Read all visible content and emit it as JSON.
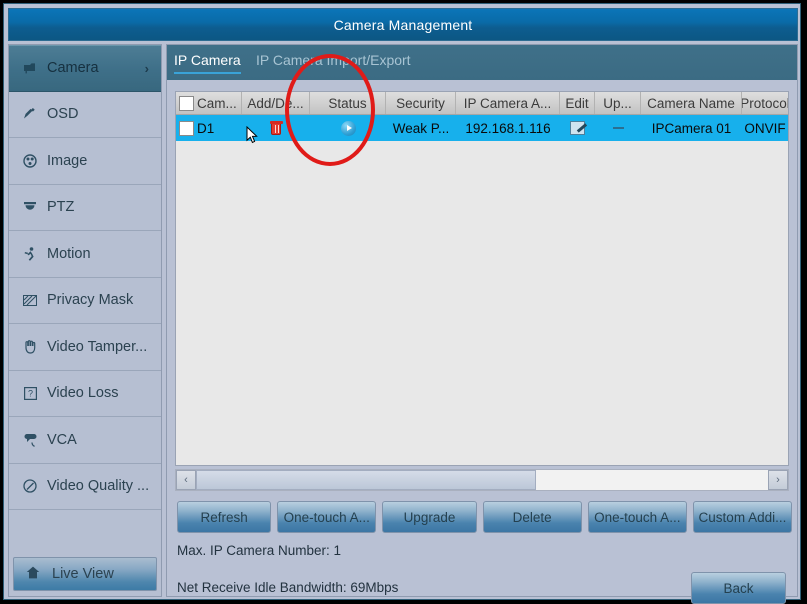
{
  "window": {
    "title": "Camera Management"
  },
  "sidebar": {
    "items": [
      {
        "label": "Camera",
        "icon": "camera-icon",
        "active": true,
        "chevron": "›"
      },
      {
        "label": "OSD",
        "icon": "osd-icon",
        "active": false,
        "chevron": ""
      },
      {
        "label": "Image",
        "icon": "image-icon",
        "active": false,
        "chevron": ""
      },
      {
        "label": "PTZ",
        "icon": "ptz-icon",
        "active": false,
        "chevron": ""
      },
      {
        "label": "Motion",
        "icon": "motion-icon",
        "active": false,
        "chevron": ""
      },
      {
        "label": "Privacy Mask",
        "icon": "privacy-mask-icon",
        "active": false,
        "chevron": ""
      },
      {
        "label": "Video Tamper...",
        "icon": "video-tamper-icon",
        "active": false,
        "chevron": ""
      },
      {
        "label": "Video Loss",
        "icon": "video-loss-icon",
        "active": false,
        "chevron": ""
      },
      {
        "label": "VCA",
        "icon": "vca-icon",
        "active": false,
        "chevron": ""
      },
      {
        "label": "Video Quality ...",
        "icon": "video-quality-icon",
        "active": false,
        "chevron": ""
      }
    ],
    "live_view": {
      "label": "Live View",
      "icon": "home-icon"
    }
  },
  "tabs": [
    {
      "label": "IP Camera",
      "active": true
    },
    {
      "label": "IP Camera Import/Export",
      "active": false
    }
  ],
  "table": {
    "columns": [
      "Cam...",
      "Add/De...",
      "Status",
      "Security",
      "IP Camera A...",
      "Edit",
      "Up...",
      "Camera Name",
      "Protocol"
    ],
    "rows": [
      {
        "channel": "D1",
        "add_delete_icon": "delete-trash-icon",
        "status_icon": "play-circle-icon",
        "security": "Weak P...",
        "ip_address": "192.168.1.116",
        "edit_icon": "edit-pencil-icon",
        "upgrade": "—",
        "camera_name": "IPCamera 01",
        "protocol": "ONVIF",
        "selected": true,
        "checked": false
      }
    ],
    "header_checkbox_checked": false
  },
  "scrollbar": {
    "left_arrow": "‹",
    "right_arrow": "›"
  },
  "action_buttons": [
    {
      "label": "Refresh"
    },
    {
      "label": "One-touch A..."
    },
    {
      "label": "Upgrade"
    },
    {
      "label": "Delete"
    },
    {
      "label": "One-touch A..."
    },
    {
      "label": "Custom Addi..."
    }
  ],
  "info": {
    "max_cameras": "Max. IP Camera Number: 1",
    "bandwidth": "Net Receive Idle Bandwidth: 69Mbps"
  },
  "back_button": {
    "label": "Back"
  },
  "annotation": {
    "shape": "ellipse-highlight",
    "color": "#e01b18",
    "target": "Status"
  },
  "colors": {
    "title_bar": "#0a6ba8",
    "tab_strip": "#3f7089",
    "row_selected": "#17b0ec",
    "panel_background": "#b9c1d4",
    "annotation_red": "#e01b18"
  }
}
